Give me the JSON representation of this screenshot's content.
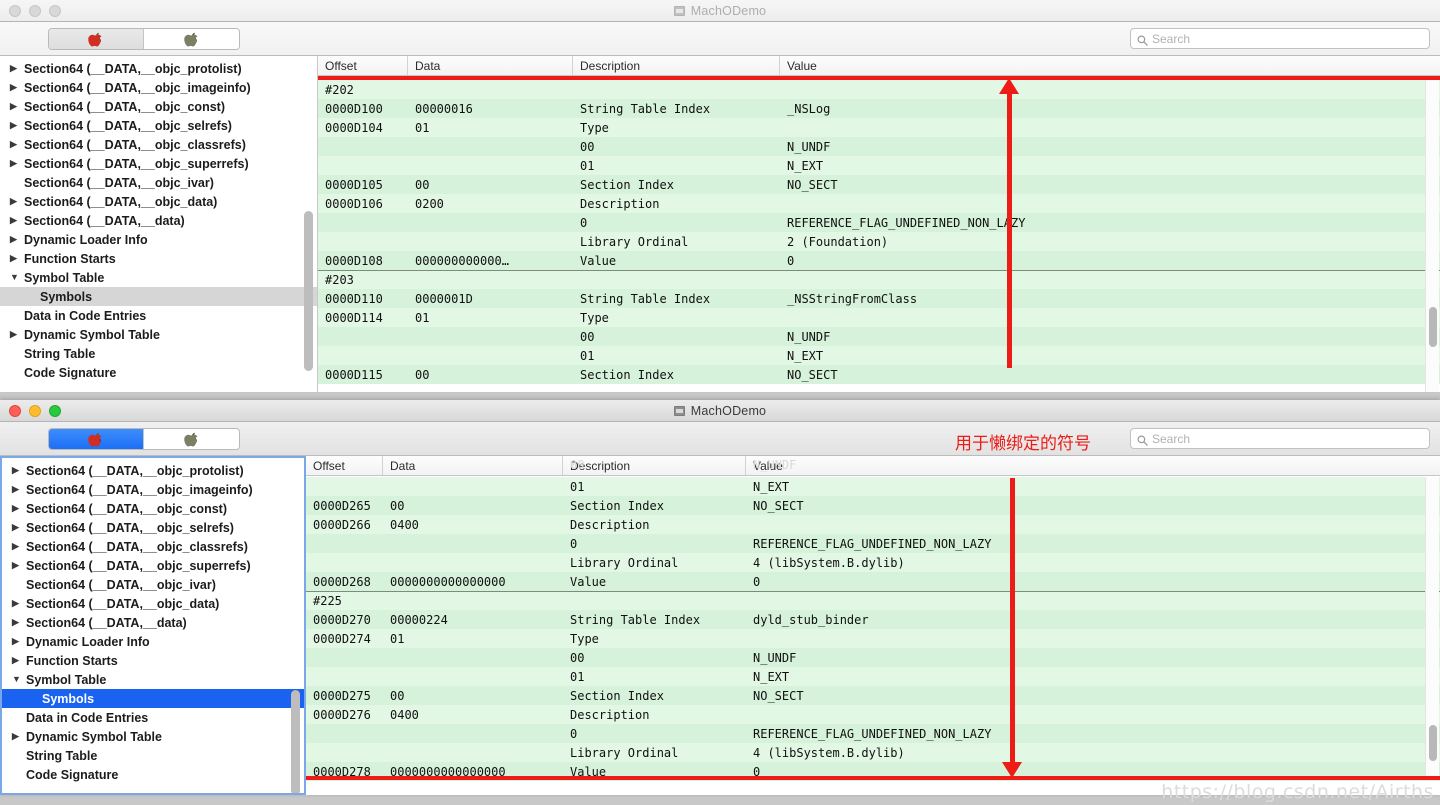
{
  "app": {
    "title": "MachODemo"
  },
  "toolbar": {
    "segments": [
      {
        "name": "red-apple",
        "icon": "apple-red-icon"
      },
      {
        "name": "gray-apple",
        "icon": "apple-gray-icon"
      }
    ],
    "search_placeholder": "Search",
    "search_value": ""
  },
  "sidebar": {
    "items": [
      {
        "label": "Section64 (__DATA,__objc_protolist)",
        "disclosure": "collapsed",
        "indent": 0
      },
      {
        "label": "Section64 (__DATA,__objc_imageinfo)",
        "disclosure": "collapsed",
        "indent": 0
      },
      {
        "label": "Section64 (__DATA,__objc_const)",
        "disclosure": "collapsed",
        "indent": 0
      },
      {
        "label": "Section64 (__DATA,__objc_selrefs)",
        "disclosure": "collapsed",
        "indent": 0
      },
      {
        "label": "Section64 (__DATA,__objc_classrefs)",
        "disclosure": "collapsed",
        "indent": 0
      },
      {
        "label": "Section64 (__DATA,__objc_superrefs)",
        "disclosure": "collapsed",
        "indent": 0
      },
      {
        "label": "Section64 (__DATA,__objc_ivar)",
        "disclosure": "none",
        "indent": 0
      },
      {
        "label": "Section64 (__DATA,__objc_data)",
        "disclosure": "collapsed",
        "indent": 0
      },
      {
        "label": "Section64 (__DATA,__data)",
        "disclosure": "collapsed",
        "indent": 0
      },
      {
        "label": "Dynamic Loader Info",
        "disclosure": "collapsed",
        "indent": 0
      },
      {
        "label": "Function Starts",
        "disclosure": "collapsed",
        "indent": 0
      },
      {
        "label": "Symbol Table",
        "disclosure": "expanded",
        "indent": 0
      },
      {
        "label": "Symbols",
        "disclosure": "none",
        "indent": 1,
        "selected": true
      },
      {
        "label": "Data in Code Entries",
        "disclosure": "none",
        "indent": 0
      },
      {
        "label": "Dynamic Symbol Table",
        "disclosure": "collapsed",
        "indent": 0
      },
      {
        "label": "String Table",
        "disclosure": "none",
        "indent": 0
      },
      {
        "label": "Code Signature",
        "disclosure": "none",
        "indent": 0
      }
    ]
  },
  "table": {
    "columns": [
      "Offset",
      "Data",
      "Description",
      "Value"
    ]
  },
  "top_window": {
    "active": false,
    "rows": [
      {
        "offset": "#202",
        "data": "",
        "description": "",
        "value": "",
        "group": true
      },
      {
        "offset": "0000D100",
        "data": "00000016",
        "description": "String Table Index",
        "value": "_NSLog"
      },
      {
        "offset": "0000D104",
        "data": "01",
        "description": "Type",
        "value": ""
      },
      {
        "offset": "",
        "data": "",
        "description": "00",
        "value": "N_UNDF"
      },
      {
        "offset": "",
        "data": "",
        "description": "01",
        "value": "N_EXT"
      },
      {
        "offset": "0000D105",
        "data": "00",
        "description": "Section Index",
        "value": "NO_SECT"
      },
      {
        "offset": "0000D106",
        "data": "0200",
        "description": "Description",
        "value": ""
      },
      {
        "offset": "",
        "data": "",
        "description": "0",
        "value": "REFERENCE_FLAG_UNDEFINED_NON_LAZY"
      },
      {
        "offset": "",
        "data": "",
        "description": "Library Ordinal",
        "value": "2 (Foundation)"
      },
      {
        "offset": "0000D108",
        "data": "000000000000…",
        "description": "Value",
        "value": "0"
      },
      {
        "offset": "#203",
        "data": "",
        "description": "",
        "value": "",
        "group": true,
        "sep": true
      },
      {
        "offset": "0000D110",
        "data": "0000001D",
        "description": "String Table Index",
        "value": "_NSStringFromClass"
      },
      {
        "offset": "0000D114",
        "data": "01",
        "description": "Type",
        "value": ""
      },
      {
        "offset": "",
        "data": "",
        "description": "00",
        "value": "N_UNDF"
      },
      {
        "offset": "",
        "data": "",
        "description": "01",
        "value": "N_EXT"
      },
      {
        "offset": "0000D115",
        "data": "00",
        "description": "Section Index",
        "value": "NO_SECT"
      }
    ]
  },
  "bottom_window": {
    "active": true,
    "ghost_row": {
      "description": "00",
      "value": "N_UNDF"
    },
    "rows": [
      {
        "offset": "",
        "data": "",
        "description": "01",
        "value": "N_EXT"
      },
      {
        "offset": "0000D265",
        "data": "00",
        "description": "Section Index",
        "value": "NO_SECT"
      },
      {
        "offset": "0000D266",
        "data": "0400",
        "description": "Description",
        "value": ""
      },
      {
        "offset": "",
        "data": "",
        "description": "0",
        "value": "REFERENCE_FLAG_UNDEFINED_NON_LAZY"
      },
      {
        "offset": "",
        "data": "",
        "description": "Library Ordinal",
        "value": "4 (libSystem.B.dylib)"
      },
      {
        "offset": "0000D268",
        "data": "0000000000000000",
        "description": "Value",
        "value": "0"
      },
      {
        "offset": "#225",
        "data": "",
        "description": "",
        "value": "",
        "group": true,
        "sep": true
      },
      {
        "offset": "0000D270",
        "data": "00000224",
        "description": "String Table Index",
        "value": "dyld_stub_binder"
      },
      {
        "offset": "0000D274",
        "data": "01",
        "description": "Type",
        "value": ""
      },
      {
        "offset": "",
        "data": "",
        "description": "00",
        "value": "N_UNDF"
      },
      {
        "offset": "",
        "data": "",
        "description": "01",
        "value": "N_EXT"
      },
      {
        "offset": "0000D275",
        "data": "00",
        "description": "Section Index",
        "value": "NO_SECT"
      },
      {
        "offset": "0000D276",
        "data": "0400",
        "description": "Description",
        "value": ""
      },
      {
        "offset": "",
        "data": "",
        "description": "0",
        "value": "REFERENCE_FLAG_UNDEFINED_NON_LAZY"
      },
      {
        "offset": "",
        "data": "",
        "description": "Library Ordinal",
        "value": "4 (libSystem.B.dylib)"
      },
      {
        "offset": "0000D278",
        "data": "0000000000000000",
        "description": "Value",
        "value": "0"
      }
    ]
  },
  "annotations": {
    "lazy_binding_note": "用于懒绑定的符号",
    "watermark": "https://blog.csdn.net/Airths",
    "accent_red": "#ee1c16",
    "selection_blue": "#1a62f0",
    "row_green_a": "#e2f7e4",
    "row_green_b": "#d6f2da"
  }
}
